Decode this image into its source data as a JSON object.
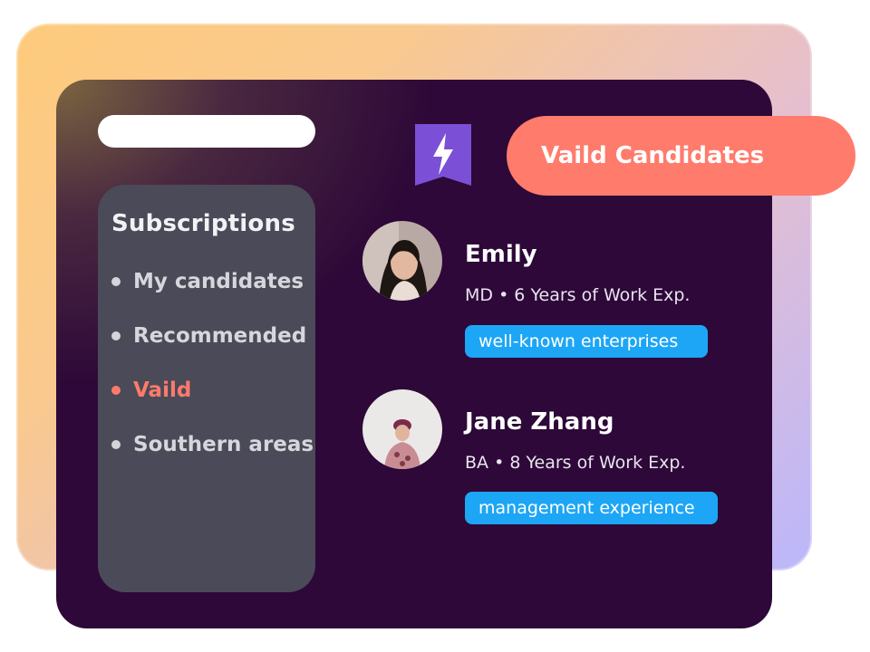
{
  "sidebar": {
    "title": "Subscriptions",
    "items": [
      {
        "label": "My candidates",
        "active": false
      },
      {
        "label": "Recommended",
        "active": false
      },
      {
        "label": "Vaild",
        "active": true
      },
      {
        "label": "Southern areas",
        "active": false
      }
    ]
  },
  "header": {
    "badge_icon": "lightning-bookmark-icon",
    "banner_label": "Vaild Candidates"
  },
  "candidates": [
    {
      "name": "Emily",
      "meta": "MD • 6 Years of Work Exp.",
      "tag": "well-known enterprises"
    },
    {
      "name": "Jane Zhang",
      "meta": "BA • 8 Years of Work Exp.",
      "tag": "management experience"
    }
  ],
  "colors": {
    "accent": "#ff7b6c",
    "tag": "#1da6f5",
    "card": "#2d0838",
    "sidebar": "#4a4a58",
    "icon": "#7b4fd6"
  }
}
